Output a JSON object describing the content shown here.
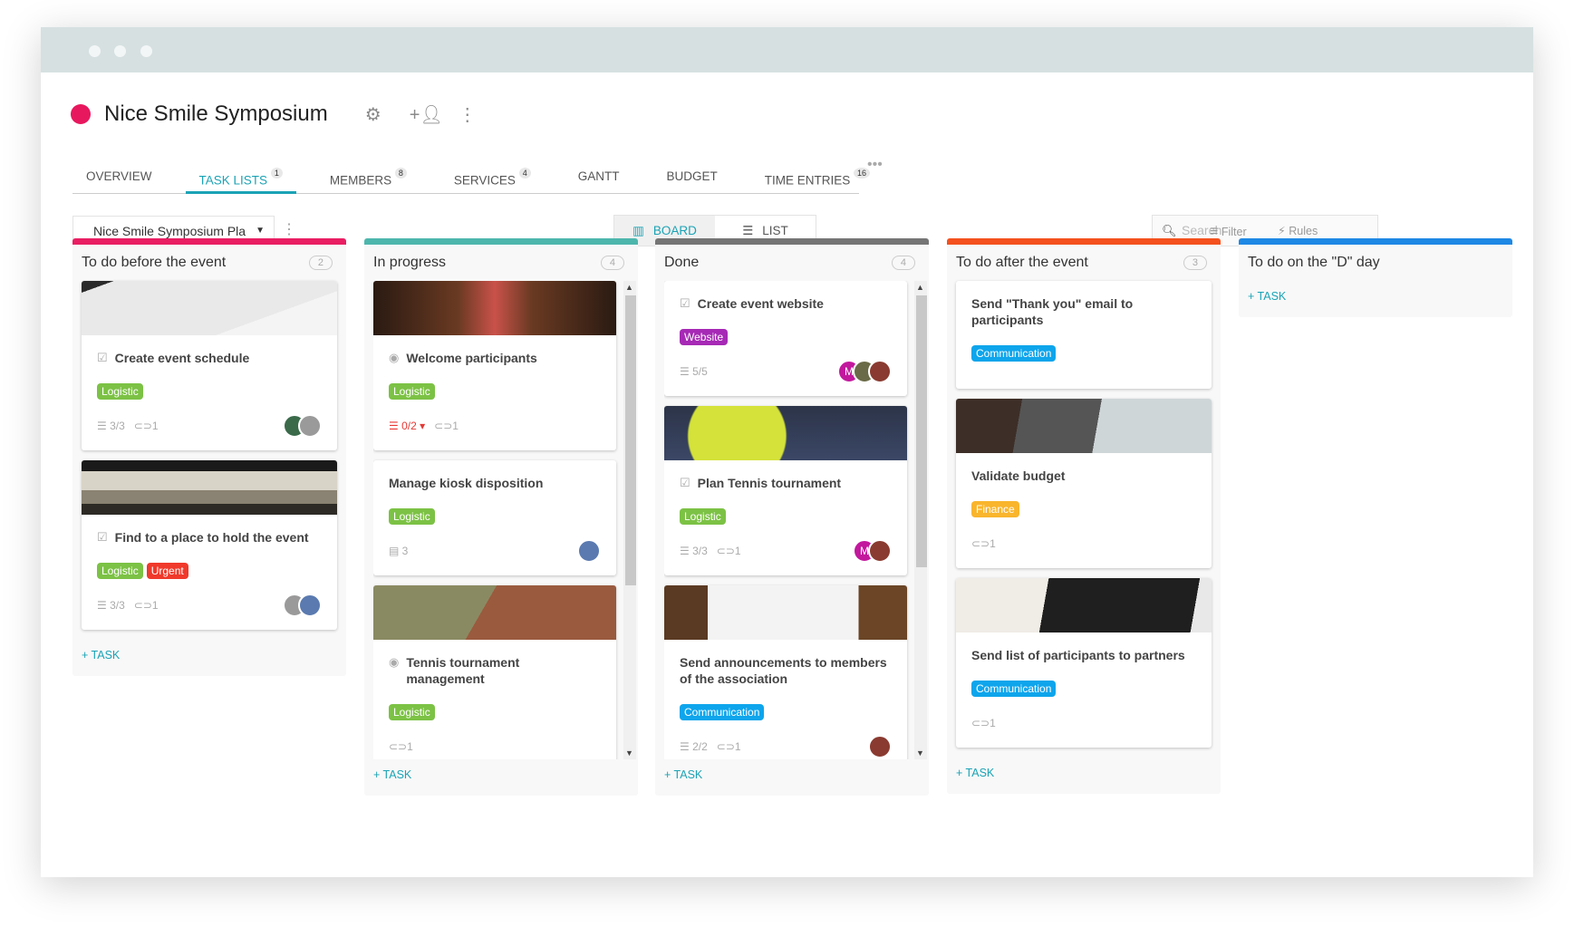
{
  "project": {
    "title": "Nice Smile Symposium",
    "color": "#e8185e"
  },
  "header_icons": [
    "gear-icon",
    "add-member-icon",
    "more-vertical-icon"
  ],
  "tabs": [
    {
      "label": "OVERVIEW",
      "badge": ""
    },
    {
      "label": "TASK LISTS",
      "badge": "1",
      "active": true
    },
    {
      "label": "MEMBERS",
      "badge": "8"
    },
    {
      "label": "SERVICES",
      "badge": "4"
    },
    {
      "label": "GANTT",
      "badge": ""
    },
    {
      "label": "BUDGET",
      "badge": ""
    },
    {
      "label": "TIME ENTRIES",
      "badge": "16"
    }
  ],
  "toolbar": {
    "plan_select": "Nice Smile Symposium Pla",
    "board": "BOARD",
    "list": "LIST",
    "search_placeholder": "Search",
    "filter": "Filter",
    "rules": "Rules"
  },
  "add_task": "+ TASK",
  "tag_colors": {
    "Logistic": "#7cc245",
    "Urgent": "#f0392b",
    "Website": "#a629b5",
    "Communication": "#0ea5ec",
    "Finance": "#f9b52c"
  },
  "columns": [
    {
      "title": "To do before the event",
      "count": "2",
      "color": "#e91e63",
      "cards": [
        {
          "image": "schedule",
          "icon": "checkbox",
          "title": "Create event schedule",
          "tags": [
            "Logistic"
          ],
          "checklist": "3/3",
          "attachments": "1",
          "avatars": [
            "photo-green",
            "photo-cat"
          ]
        },
        {
          "image": "hall",
          "icon": "checkbox",
          "title": "Find to a place to hold the event",
          "tags": [
            "Logistic",
            "Urgent"
          ],
          "checklist": "3/3",
          "attachments": "1",
          "avatars": [
            "photo-cat",
            "photo-man"
          ]
        }
      ]
    },
    {
      "title": "In progress",
      "count": "4",
      "color": "#4db6ac",
      "scroll": true,
      "cards": [
        {
          "image": "corridor",
          "icon": "eye",
          "title": "Welcome participants",
          "tags": [
            "Logistic"
          ],
          "checklist": "0/2",
          "checklist_alert": true,
          "attachments": "1",
          "avatars": []
        },
        {
          "icon": "",
          "title": "Manage kiosk disposition",
          "tags": [
            "Logistic"
          ],
          "comments": "3",
          "avatars": [
            "photo-man"
          ]
        },
        {
          "image": "net",
          "icon": "eye",
          "title": "Tennis tournament management",
          "tags": [
            "Logistic"
          ],
          "attachments": "1",
          "avatars": []
        },
        {
          "image": "purple",
          "icon": "",
          "title": "",
          "tags": [],
          "avatars": []
        }
      ]
    },
    {
      "title": "Done",
      "count": "4",
      "color": "#757575",
      "scroll": true,
      "cards": [
        {
          "icon": "checkbox",
          "title": "Create event website",
          "tags": [
            "Website"
          ],
          "checklist": "5/5",
          "avatars": [
            "M",
            "photo-group",
            "photo-red"
          ]
        },
        {
          "image": "ball",
          "icon": "checkbox",
          "title": "Plan Tennis tournament",
          "tags": [
            "Logistic"
          ],
          "checklist": "3/3",
          "attachments": "1",
          "avatars": [
            "M",
            "photo-red"
          ]
        },
        {
          "image": "calendar",
          "icon": "",
          "title": "Send announcements to members of the association",
          "tags": [
            "Communication"
          ],
          "checklist": "2/2",
          "attachments": "1",
          "avatars": [
            "photo-red"
          ]
        }
      ]
    },
    {
      "title": "To do after the event",
      "count": "3",
      "color": "#f4511e",
      "cards": [
        {
          "icon": "",
          "title": "Send \"Thank you\" email to participants",
          "tags": [
            "Communication"
          ],
          "avatars": [],
          "empty_footer": true
        },
        {
          "image": "laptop",
          "icon": "",
          "title": "Validate budget",
          "tags": [
            "Finance"
          ],
          "attachments": "1",
          "avatars": []
        },
        {
          "image": "laptop2",
          "icon": "",
          "title": "Send list of participants to partners",
          "tags": [
            "Communication"
          ],
          "attachments": "1",
          "avatars": []
        }
      ]
    },
    {
      "title": "To do on the \"D\" day",
      "count": "",
      "color": "#1e88e5",
      "cards": []
    }
  ]
}
